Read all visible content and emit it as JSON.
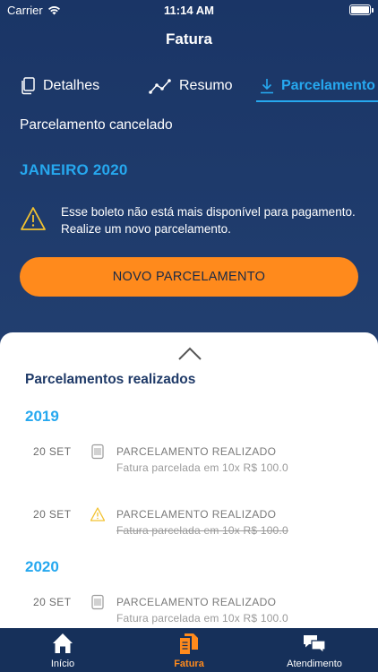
{
  "status_bar": {
    "carrier": "Carrier",
    "time": "11:14 AM"
  },
  "header": {
    "title": "Fatura"
  },
  "tabs": [
    {
      "label": "Detalhes",
      "icon": "document-icon"
    },
    {
      "label": "Resumo",
      "icon": "line-chart-icon"
    },
    {
      "label": "Parcelamento",
      "icon": "download-icon",
      "active": true
    }
  ],
  "installment": {
    "status": "Parcelamento cancelado",
    "month": "JANEIRO 2020",
    "warning": "Esse boleto não está mais disponível para pagamento. Realize um novo parcelamento.",
    "cta_label": "NOVO PARCELAMENTO"
  },
  "history": {
    "title": "Parcelamentos realizados",
    "years": [
      {
        "year": "2019",
        "entries": [
          {
            "date": "20 SET",
            "title": "PARCELAMENTO REALIZADO",
            "description": "Fatura parcelada em 10x R$ 100.0",
            "icon": "barcode-icon",
            "cancelled": false
          },
          {
            "date": "20 SET",
            "title": "PARCELAMENTO REALIZADO",
            "description": "Fatura parcelada em 10x R$ 100.0",
            "icon": "warning-icon",
            "cancelled": true
          }
        ]
      },
      {
        "year": "2020",
        "entries": [
          {
            "date": "20 SET",
            "title": "PARCELAMENTO REALIZADO",
            "description": "Fatura parcelada em 10x R$ 100.0",
            "icon": "barcode-icon",
            "cancelled": false
          }
        ]
      }
    ]
  },
  "tabbar": [
    {
      "label": "Início",
      "icon": "home-icon"
    },
    {
      "label": "Fatura",
      "icon": "invoice-icon",
      "active": true
    },
    {
      "label": "Atendimento",
      "icon": "chat-icon"
    }
  ],
  "colors": {
    "background": "#1f3a68",
    "accent_blue": "#26a8ef",
    "accent_orange": "#ff8a1c",
    "warning_yellow": "#f2c230"
  }
}
